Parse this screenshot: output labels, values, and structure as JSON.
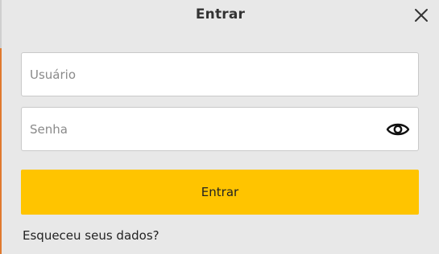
{
  "modal": {
    "title": "Entrar",
    "close_icon": "close-icon"
  },
  "form": {
    "username_placeholder": "Usuário",
    "username_value": "",
    "password_placeholder": "Senha",
    "password_value": "",
    "password_toggle_icon": "eye-icon",
    "submit_label": "Entrar",
    "forgot_link": "Esqueceu seus dados?"
  },
  "colors": {
    "accent": "#ffc400",
    "modal_background": "#e8e8e8",
    "text": "#222222"
  }
}
